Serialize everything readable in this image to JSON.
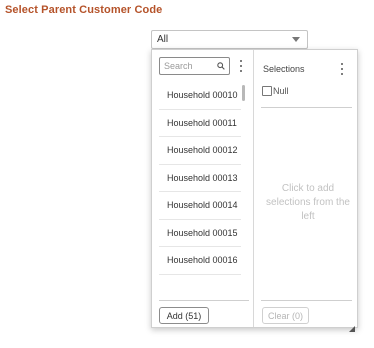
{
  "field_label": "Select Parent Customer Code",
  "select": {
    "value": "All"
  },
  "dropdown": {
    "search": {
      "placeholder": "Search"
    },
    "list_items": [
      "Household 00010",
      "Household 00011",
      "Household 00012",
      "Household 00013",
      "Household 00014",
      "Household 00015",
      "Household 00016"
    ],
    "add_button_label": "Add (51)",
    "selections": {
      "title": "Selections",
      "null_label": "Null",
      "empty_hint": "Click to add selections from the left",
      "clear_button_label": "Clear (0)"
    }
  },
  "icons": {
    "search": "search-icon",
    "more_options": "kebab-menu-icon",
    "dropdown_caret": "chevron-down-icon",
    "resize": "resize-grip-icon"
  },
  "colors": {
    "label": "#b5532a",
    "text": "#333333",
    "hint": "#c2c2c2",
    "border": "#c4c4c4"
  }
}
